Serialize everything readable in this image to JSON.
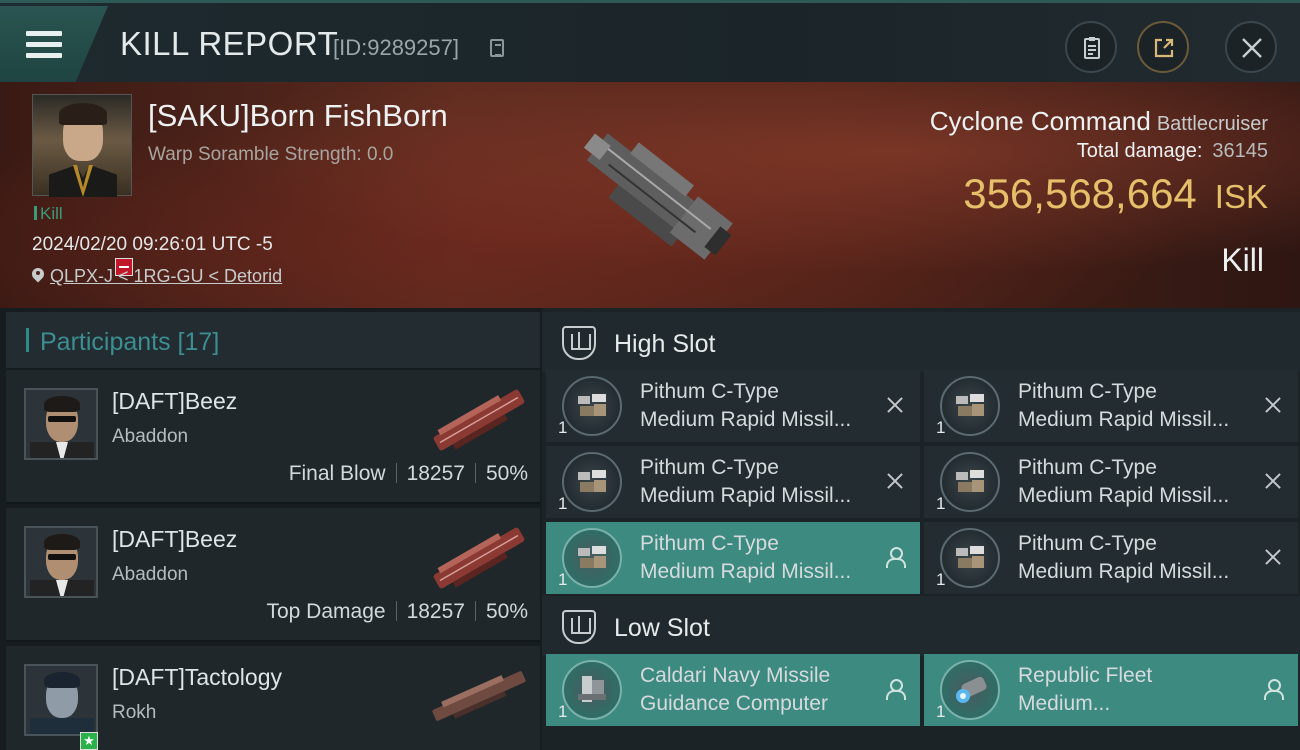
{
  "window": {
    "title": "KILL REPORT",
    "report_id": "[ID:9289257]"
  },
  "victim": {
    "name": "[SAKU]Born FishBorn",
    "warp_scramble": "Warp Soramble Strength: 0.0",
    "tag": "Kill",
    "datetime": "2024/02/20 09:26:01 UTC -5",
    "location": "QLPX-J < 1RG-GU < Detorid",
    "ship_name": "Cyclone Command",
    "ship_class": "Battlecruiser",
    "total_damage_label": "Total damage:",
    "total_damage": "36145",
    "isk_value": "356,568,664",
    "isk_unit": "ISK",
    "result": "Kill"
  },
  "participants": {
    "title": "Participants [17]",
    "rows": [
      {
        "name": "[DAFT]Beez",
        "ship": "Abaddon",
        "role": "Final Blow",
        "damage": "18257",
        "percent": "50%"
      },
      {
        "name": "[DAFT]Beez",
        "ship": "Abaddon",
        "role": "Top Damage",
        "damage": "18257",
        "percent": "50%"
      },
      {
        "name": "[DAFT]Tactology",
        "ship": "Rokh",
        "role": "",
        "damage": "",
        "percent": ""
      }
    ]
  },
  "slots": {
    "high": {
      "label": "High Slot",
      "modules": [
        {
          "line1": "Pithum C-Type",
          "line2": "Medium Rapid Missil...",
          "qty": "1",
          "state": "destroyed"
        },
        {
          "line1": "Pithum C-Type",
          "line2": "Medium Rapid Missil...",
          "qty": "1",
          "state": "destroyed"
        },
        {
          "line1": "Pithum C-Type",
          "line2": "Medium Rapid Missil...",
          "qty": "1",
          "state": "destroyed"
        },
        {
          "line1": "Pithum C-Type",
          "line2": "Medium Rapid Missil...",
          "qty": "1",
          "state": "destroyed"
        },
        {
          "line1": "Pithum C-Type",
          "line2": "Medium Rapid Missil...",
          "qty": "1",
          "state": "dropped"
        },
        {
          "line1": "Pithum C-Type",
          "line2": "Medium Rapid Missil...",
          "qty": "1",
          "state": "destroyed"
        }
      ]
    },
    "low": {
      "label": "Low Slot",
      "modules": [
        {
          "line1": "Caldari Navy Missile",
          "line2": "Guidance Computer",
          "qty": "1",
          "state": "dropped"
        },
        {
          "line1": "Republic Fleet",
          "line2": "Medium...",
          "qty": "1",
          "state": "dropped"
        }
      ]
    }
  },
  "colors": {
    "accent_teal": "#3d8a80",
    "isk_gold": "#e6bf6a",
    "kill_green": "#3a9a7a",
    "danger_red": "#c0182a"
  },
  "icons": {
    "menu": "hamburger-icon",
    "copy": "copy-icon",
    "clipboard": "clipboard-icon",
    "export": "export-icon",
    "close": "close-icon",
    "location": "location-pin-icon",
    "slot": "slot-shield-icon",
    "destroyed": "x-icon",
    "dropped": "person-icon"
  }
}
